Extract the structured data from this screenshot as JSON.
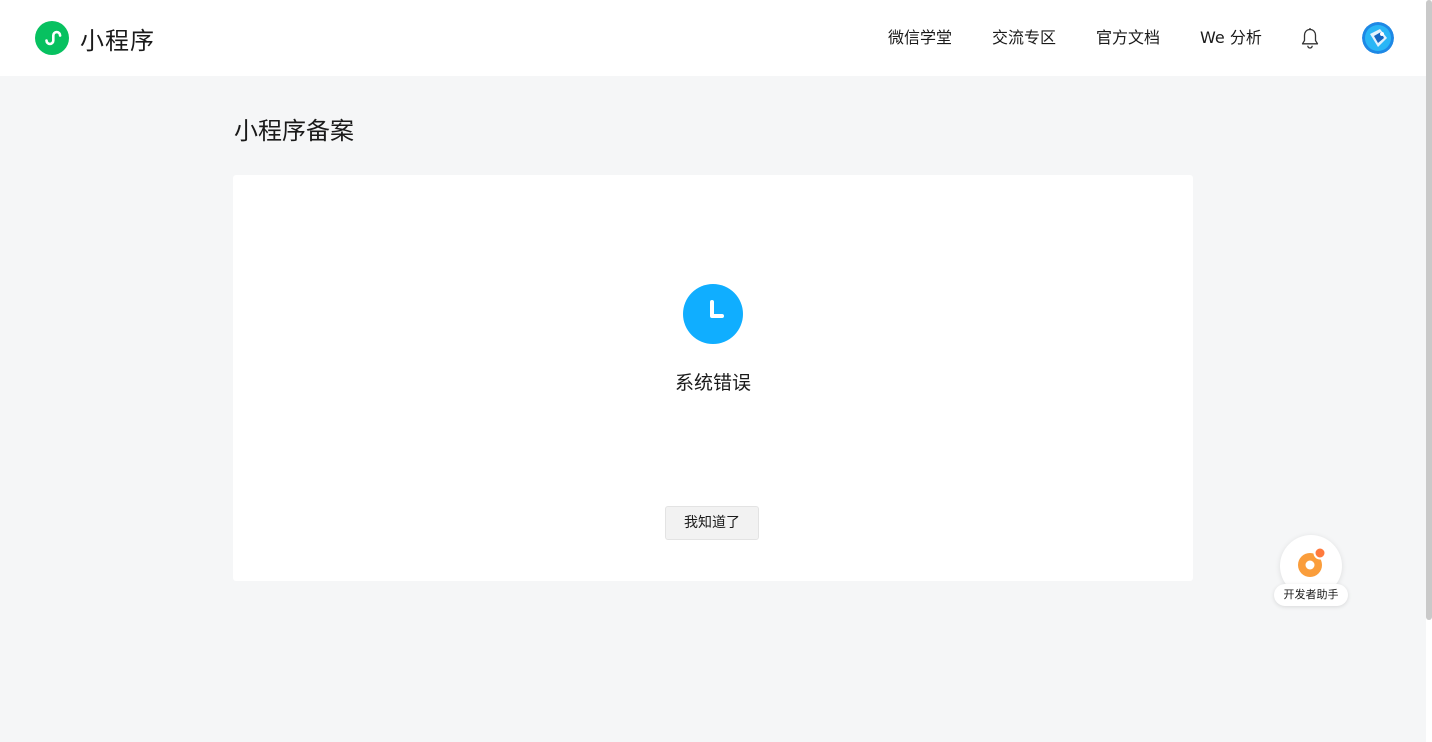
{
  "header": {
    "brand_name": "小程序",
    "nav": [
      {
        "label": "微信学堂"
      },
      {
        "label": "交流专区"
      },
      {
        "label": "官方文档"
      },
      {
        "label": "We 分析"
      }
    ],
    "icons": {
      "logo": "miniprogram-logo-icon",
      "bell": "bell-icon",
      "avatar": "user-avatar"
    }
  },
  "page": {
    "title": "小程序备案"
  },
  "notice": {
    "icon": "clock-icon",
    "message": "系统错误",
    "button_label": "我知道了"
  },
  "assistant": {
    "label": "开发者助手",
    "icon": "developer-assistant-icon"
  },
  "colors": {
    "brand_green": "#07c160",
    "status_blue": "#10aeff",
    "assistant_orange": "#fa9d3b",
    "page_background": "#f5f6f7"
  }
}
